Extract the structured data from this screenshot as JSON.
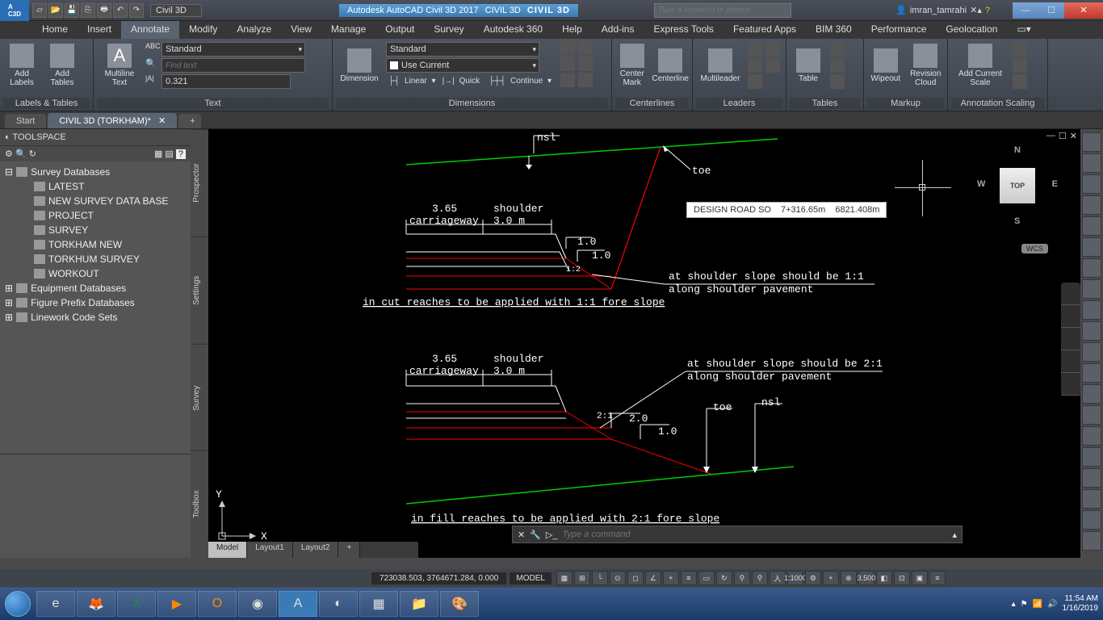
{
  "titlebar": {
    "workspace": "Civil 3D",
    "app_title": "Autodesk AutoCAD Civil 3D 2017",
    "doc_title": "CIVIL 3D",
    "brand": "CIVIL 3D",
    "search_placeholder": "Type a keyword or phrase",
    "user": "imran_tamrahi"
  },
  "menu": [
    "Home",
    "Insert",
    "Annotate",
    "Modify",
    "Analyze",
    "View",
    "Manage",
    "Output",
    "Survey",
    "Autodesk 360",
    "Help",
    "Add-ins",
    "Express Tools",
    "Featured Apps",
    "BIM 360",
    "Performance",
    "Geolocation"
  ],
  "menu_active": "Annotate",
  "ribbon": {
    "labels_tables": {
      "add_labels": "Add Labels",
      "add_tables": "Add Tables",
      "title": "Labels & Tables"
    },
    "text": {
      "mtext": "Multiline Text",
      "style": "Standard",
      "find_placeholder": "Find text",
      "height": "0.321",
      "title": "Text"
    },
    "dimensions": {
      "btn": "Dimension",
      "style": "Standard",
      "layer": "Use Current",
      "linear": "Linear",
      "quick": "Quick",
      "continue": "Continue",
      "title": "Dimensions"
    },
    "centerlines": {
      "center_mark": "Center Mark",
      "centerline": "Centerline",
      "title": "Centerlines"
    },
    "leaders": {
      "btn": "Multileader",
      "title": "Leaders"
    },
    "tables": {
      "btn": "Table",
      "title": "Tables"
    },
    "markup": {
      "wipeout": "Wipeout",
      "revcloud": "Revision Cloud",
      "title": "Markup"
    },
    "anno_scale": {
      "btn": "Add Current Scale",
      "title": "Annotation Scaling"
    }
  },
  "file_tabs": {
    "start": "Start",
    "active": "CIVIL 3D (TORKHAM)*"
  },
  "toolspace": {
    "title": "TOOLSPACE",
    "root": "Survey Databases",
    "items": [
      "LATEST",
      "NEW SURVEY DATA BASE",
      "PROJECT",
      "SURVEY",
      "TORKHAM NEW",
      "TORKHUM SURVEY",
      "WORKOUT"
    ],
    "equip": "Equipment Databases",
    "figure": "Figure Prefix Databases",
    "linework": "Linework Code Sets",
    "vtabs": [
      "Prospector",
      "Settings",
      "Survey",
      "Toolbox"
    ]
  },
  "canvas": {
    "nsl": "nsl",
    "toe": "toe",
    "dim_365": "3.65",
    "carriageway": "carriageway",
    "shoulder": "shoulder",
    "dim_30": "3.0  m",
    "r_10": "1.0",
    "r_12": "1:2",
    "note1_a": "at shoulder slope should be 1:1",
    "note1_b": "along shoulder pavement",
    "title1": "in cut reaches to be applied with 1:1 fore slope",
    "note2_a": "at shoulder slope should be 2:1",
    "note2_b": "along shoulder pavement",
    "r_21": "2:1",
    "r_20": "2.0",
    "title2": "in fill reaches to be applied with 2:1 fore slope",
    "axis_x": "X",
    "axis_y": "Y",
    "mini_ctrl": {
      "min": "—",
      "max": "☐",
      "close": "✕"
    }
  },
  "info_box": {
    "label": "DESIGN ROAD   SO",
    "chain": "7+316.65m",
    "elev": "6821.408m"
  },
  "viewcube": {
    "top": "TOP",
    "n": "N",
    "s": "S",
    "e": "E",
    "w": "W",
    "wcs": "WCS"
  },
  "cmdline_placeholder": "Type a command",
  "layout_tabs": [
    "Model",
    "Layout1",
    "Layout2"
  ],
  "status": {
    "coords": "723038.503, 3764671.284, 0.000",
    "mode": "MODEL",
    "scale": "1:1000",
    "elev": "3.500"
  },
  "taskbar": {
    "time": "11:54 AM",
    "date": "1/16/2019"
  }
}
